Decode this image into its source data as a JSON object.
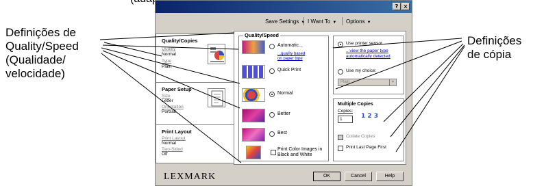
{
  "page": {
    "top_cut_text": "(adapter)"
  },
  "callouts": {
    "left": [
      "Definições de",
      "Quality/Speed",
      "(Qualidade/",
      "velocidade)"
    ],
    "right": [
      "Definições",
      "de cópia"
    ]
  },
  "window": {
    "titlebar": {
      "help": "?",
      "close": "×"
    },
    "menu": {
      "save_settings": "Save Settings",
      "i_want_to": "I Want To",
      "options": "Options"
    },
    "sidebar": {
      "quality": {
        "title": "Quality/Copies",
        "quality_label": "Quality",
        "quality_value": "Normal",
        "type_label": "Type",
        "type_value": "Plain"
      },
      "paper": {
        "title": "Paper Setup",
        "size_label": "Size",
        "size_value": "Letter",
        "orientation_label": "Orientation",
        "orientation_value": "Portrait"
      },
      "layout": {
        "title": "Print Layout",
        "layout_label": "Print Layout",
        "layout_value": "Normal",
        "two_sided_label": "Two-Sided",
        "two_sided_value": "Off"
      }
    },
    "quality_speed": {
      "title": "Quality/Speed",
      "options": [
        {
          "label": "Automatic...",
          "sub1": "...quality based",
          "sub2": "on paper type",
          "selected": false
        },
        {
          "label": "Quick Print",
          "selected": false
        },
        {
          "label": "Normal",
          "selected": true
        },
        {
          "label": "Better",
          "selected": false
        },
        {
          "label": "Best",
          "selected": false
        }
      ],
      "bw_line1": "Print Color Images in",
      "bw_line2": "Black and White"
    },
    "paper_type": {
      "sensor_label": "Use printer sensor...",
      "sensor_sub1": "...view the paper type",
      "sensor_sub2": "automatically detected",
      "my_choice_label": "Use my choice:",
      "my_choice_value": "Plain"
    },
    "copies": {
      "title": "Multiple Copies",
      "copies_label": "Copies:",
      "copies_value": "1",
      "graphic_text": "1 2 3",
      "collate_label": "Collate Copies",
      "last_page_label": "Print Last Page First"
    },
    "bottom": {
      "logo": "LEXMARK",
      "ok": "OK",
      "cancel": "Cancel",
      "help": "Help"
    }
  }
}
